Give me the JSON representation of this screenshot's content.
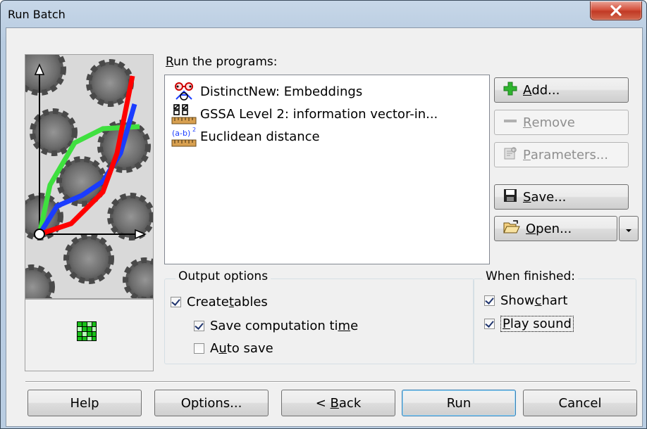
{
  "window": {
    "title": "Run Batch"
  },
  "programs": {
    "label_prefix": "R",
    "label_rest": "un the programs:",
    "items": [
      {
        "label": "DistinctNew: Embeddings",
        "icon": "distinct-embedding-icon"
      },
      {
        "label": "GSSA Level 2: information vector-in...",
        "icon": "gssa-ruler-icon"
      },
      {
        "label": "Euclidean distance",
        "icon": "euclidean-distance-icon"
      }
    ]
  },
  "buttons": {
    "add": {
      "u": "A",
      "rest": "dd..."
    },
    "remove": {
      "u": "R",
      "rest": "emove"
    },
    "parameters": {
      "u": "P",
      "rest": "arameters..."
    },
    "save": {
      "u": "S",
      "rest": "ave..."
    },
    "open": {
      "u": "O",
      "rest": "pen..."
    },
    "help": {
      "label": "Help"
    },
    "options": {
      "label": "Options..."
    },
    "back": {
      "pre": "< ",
      "u": "B",
      "rest": "ack"
    },
    "run": {
      "label": "Run"
    },
    "cancel": {
      "label": "Cancel"
    }
  },
  "output_options": {
    "title": "Output options",
    "create_tables": {
      "pre": "Create ",
      "u": "t",
      "rest": "ables",
      "checked": true
    },
    "save_time": {
      "pre": "Save computation ti",
      "u": "m",
      "rest": "e",
      "checked": true
    },
    "auto_save": {
      "pre": "A",
      "u": "u",
      "rest": "to save",
      "checked": false
    }
  },
  "when_finished": {
    "title": "When finished:",
    "show_chart": {
      "pre": "Show ",
      "u": "c",
      "rest": "hart",
      "checked": true
    },
    "play_sound": {
      "pre": "",
      "u": "P",
      "rest": "lay sound",
      "checked": true
    }
  },
  "colors": {
    "accent_green": "#3fd83f",
    "accent_red": "#ff0000",
    "accent_blue": "#1a3cff",
    "close_red": "#c94a34"
  }
}
